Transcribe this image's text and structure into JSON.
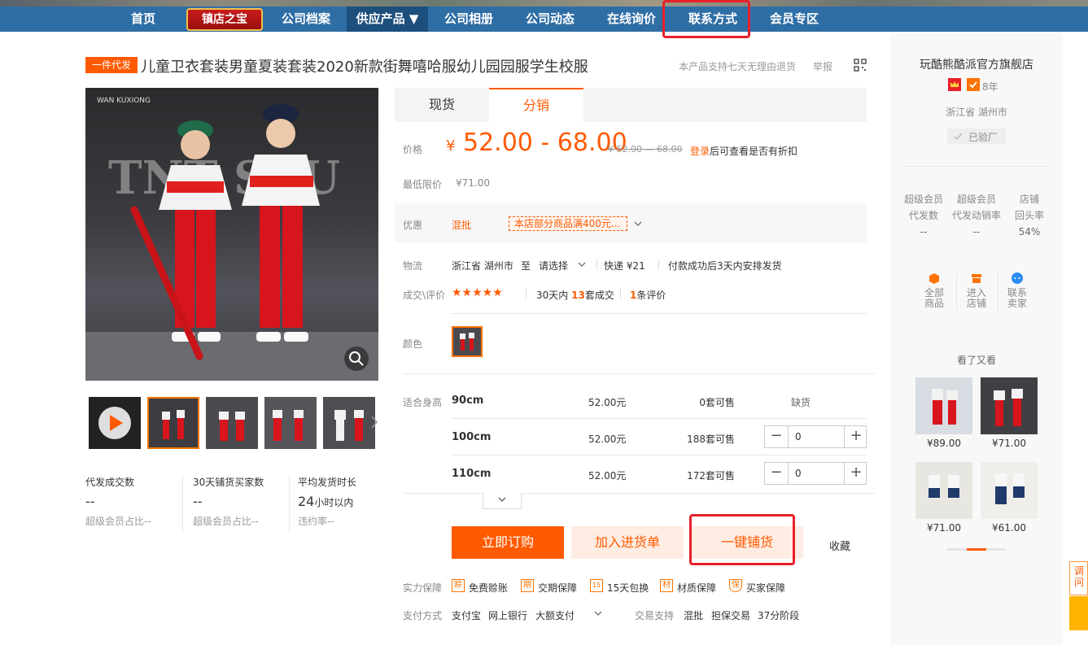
{
  "nav": {
    "items": [
      "首页",
      "公司档案",
      "供应产品 ▼",
      "公司相册",
      "公司动态",
      "在线询价",
      "联系方式",
      "会员专区"
    ],
    "shop_badge": "镇店之宝"
  },
  "product": {
    "tag": "一件代发",
    "title": "儿童卫衣套装男童夏装套装2020新款街舞嘻哈服幼儿园园服学生校服",
    "return_policy": "本产品支持七天无理由退货",
    "report": "举报",
    "image_brand": "WAN KUXIONG",
    "image_wall_text": "TNT STU"
  },
  "stats": [
    {
      "label": "代发成交数",
      "value": "--",
      "sub": "超级会员占比--"
    },
    {
      "label": "30天铺货买家数",
      "value": "--",
      "sub": "超级会员占比--"
    },
    {
      "label": "平均发货时长",
      "value": "24",
      "unit": "小时以内",
      "sub": "违约率--"
    }
  ],
  "tabs": [
    "现货",
    "分销"
  ],
  "price": {
    "label": "价格",
    "currency": "¥",
    "range": "52.00 - 68.00",
    "old": "¥ 52.00 — 68.00",
    "login": "登录",
    "login_tip": "后可查看是否有折扣",
    "min_label": "最低限价",
    "min_value": "¥71.00"
  },
  "promo": {
    "label": "优惠",
    "type": "混批",
    "text": "本店部分商品满400元..."
  },
  "logistics": {
    "label": "物流",
    "from": "浙江省 湖州市",
    "to_label": "至",
    "to": "请选择",
    "express": "快递 ¥21",
    "ship": "付款成功后3天内安排发货"
  },
  "deals": {
    "label": "成交\\评价",
    "stars": "★★★★★",
    "days": "30天内",
    "count": "13",
    "count_unit": "套成交",
    "reviews": "1",
    "reviews_unit": "条评价"
  },
  "color_label": "颜色",
  "size_label": "适合身高",
  "sizes": [
    {
      "name": "90cm",
      "price": "52.00元",
      "stock": "0套可售",
      "status": "缺货"
    },
    {
      "name": "100cm",
      "price": "52.00元",
      "stock": "188套可售",
      "qty": "0"
    },
    {
      "name": "110cm",
      "price": "52.00元",
      "stock": "172套可售",
      "qty": "0"
    }
  ],
  "actions": {
    "buy": "立即订购",
    "cart": "加入进货单",
    "distribute": "一键铺货",
    "favorite": "收藏"
  },
  "guarantee": {
    "label": "实力保障",
    "items": [
      "免费赊账",
      "交期保障",
      "15天包换",
      "材质保障",
      "买家保障"
    ],
    "icons": [
      "赊",
      "期",
      "15",
      "材",
      "保"
    ]
  },
  "payment": {
    "label": "支付方式",
    "items": [
      "支付宝",
      "网上银行",
      "大额支付"
    ],
    "trade_label": "交易支持",
    "trade_items": [
      "混批",
      "担保交易",
      "37分阶段"
    ]
  },
  "sidebar": {
    "shop_name": "玩酷熊酷派官方旗舰店",
    "years": "8年",
    "location": "浙江省 湖州市",
    "verified": "已验厂",
    "metrics": [
      {
        "label1": "超级会员",
        "label2": "代发数",
        "value": "--"
      },
      {
        "label1": "超级会员",
        "label2": "代发动销率",
        "value": "--"
      },
      {
        "label1": "店铺",
        "label2": "回头率",
        "value": "54%"
      }
    ],
    "links": [
      {
        "l1": "全部",
        "l2": "商品"
      },
      {
        "l1": "进入",
        "l2": "店铺"
      },
      {
        "l1": "联系",
        "l2": "卖家"
      }
    ],
    "seen_title": "看了又看",
    "seen_prices": [
      "¥89.00",
      "¥71.00",
      "¥71.00",
      "¥61.00"
    ]
  },
  "float_ad": {
    "text": "调问"
  },
  "colors": {
    "accent": "#ff5a00",
    "nav": "#2f6ea5",
    "highlight": "#e8202a"
  }
}
